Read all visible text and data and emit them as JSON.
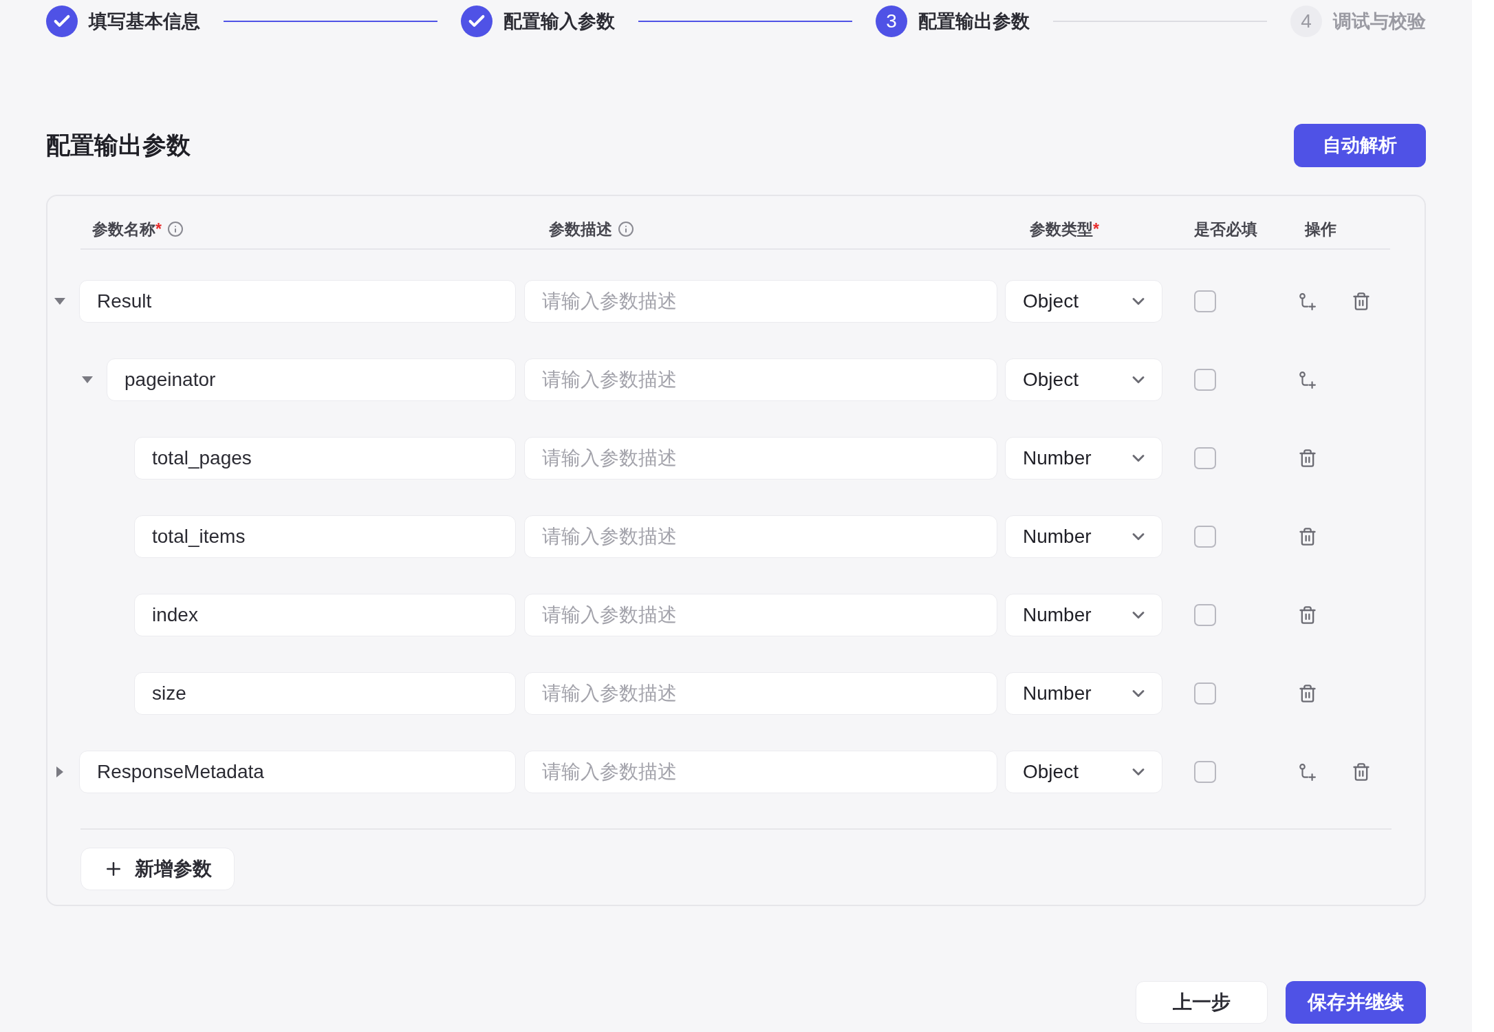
{
  "steps": [
    {
      "label": "填写基本信息",
      "done": true,
      "selected": false
    },
    {
      "label": "配置输入参数",
      "done": true,
      "selected": false
    },
    {
      "number": "3",
      "label": "配置输出参数",
      "done": false,
      "selected": true
    },
    {
      "number": "4",
      "label": "调试与校验",
      "done": false,
      "selected": false
    }
  ],
  "section": {
    "title": "配置输出参数",
    "auto_parse_button": "自动解析"
  },
  "table": {
    "columns": [
      {
        "label": "参数名称",
        "required_mark": "*",
        "info": true
      },
      {
        "label": "参数描述",
        "info": true
      },
      {
        "label": "参数类型",
        "required_mark": "*"
      },
      {
        "label": "是否必填"
      },
      {
        "label": "操作"
      }
    ],
    "rows": [
      {
        "name": "Result",
        "placeholder": "请输入参数描述",
        "type": "Object",
        "required": false,
        "can_add_child": true,
        "deletable": true,
        "expanded": true,
        "children": [
          {
            "name": "pageinator",
            "placeholder": "请输入参数描述",
            "type": "Object",
            "required": false,
            "can_add_child": true,
            "deletable": false,
            "expanded": true,
            "children": [
              {
                "name": "total_pages",
                "placeholder": "请输入参数描述",
                "type": "Number",
                "required": false,
                "can_add_child": false,
                "deletable": true
              },
              {
                "name": "total_items",
                "placeholder": "请输入参数描述",
                "type": "Number",
                "required": false,
                "can_add_child": false,
                "deletable": true
              },
              {
                "name": "index",
                "placeholder": "请输入参数描述",
                "type": "Number",
                "required": false,
                "can_add_child": false,
                "deletable": true
              },
              {
                "name": "size",
                "placeholder": "请输入参数描述",
                "type": "Number",
                "required": false,
                "can_add_child": false,
                "deletable": true
              }
            ]
          }
        ]
      },
      {
        "name": "ResponseMetadata",
        "placeholder": "请输入参数描述",
        "type": "Object",
        "required": false,
        "can_add_child": true,
        "deletable": true,
        "expanded": false,
        "children": []
      }
    ],
    "add_button": "新增参数"
  },
  "footer": {
    "prev_button": "上一步",
    "save_button": "保存并继续"
  }
}
